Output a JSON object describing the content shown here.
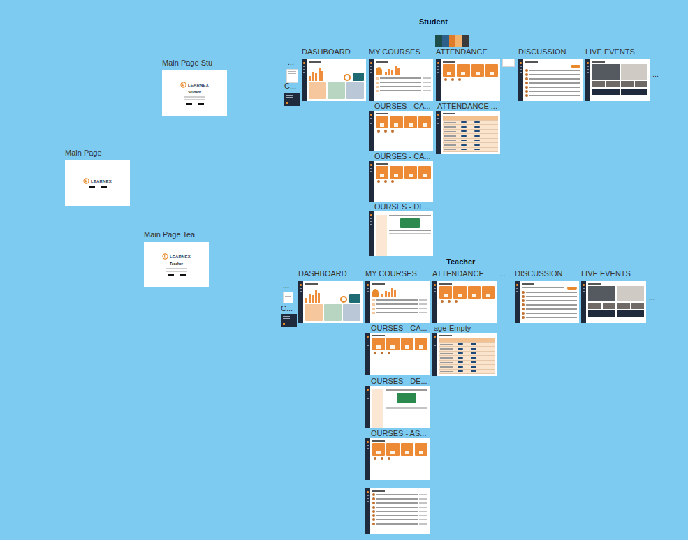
{
  "canvas": {
    "sections": [
      {
        "title": "Student"
      },
      {
        "title": "Teacher"
      }
    ]
  },
  "entry_pages": [
    {
      "label": "Main Page Stu",
      "logo": "LEARNEX",
      "heading": "Student"
    },
    {
      "label": "Main Page",
      "logo": "LEARNEX"
    },
    {
      "label": "Main Page Tea",
      "logo": "LEARNEX",
      "heading": "Teacher"
    }
  ],
  "student_frames": [
    {
      "label": "DASHBOARD",
      "kind": "dashboard"
    },
    {
      "label": "MY COURSES",
      "kind": "courses-overview"
    },
    {
      "label": "ATTENDANCE",
      "kind": "attendance-cards"
    },
    {
      "label": "DISCUSSION",
      "kind": "discussion"
    },
    {
      "label": "LIVE EVENTS",
      "kind": "live"
    },
    {
      "label": "OURSES - CA...",
      "kind": "course-cards"
    },
    {
      "label": "OURSES - CA...",
      "kind": "course-cards"
    },
    {
      "label": "OURSES - DE...",
      "kind": "detail"
    },
    {
      "label": "ATTENDANCE ...",
      "kind": "attendance-table"
    },
    {
      "label": "...",
      "kind": "mini"
    },
    {
      "label": "C...",
      "kind": "dark-mini"
    },
    {
      "label": "...",
      "kind": "mini"
    },
    {
      "label": "...",
      "kind": "note"
    },
    {
      "kind": "swatch"
    }
  ],
  "teacher_frames": [
    {
      "label": "DASHBOARD",
      "kind": "dashboard"
    },
    {
      "label": "MY COURSES",
      "kind": "courses-overview"
    },
    {
      "label": "ATTENDANCE",
      "kind": "attendance-cards"
    },
    {
      "label": "...",
      "kind": "note"
    },
    {
      "label": "DISCUSSION",
      "kind": "discussion"
    },
    {
      "label": "LIVE EVENTS",
      "kind": "live"
    },
    {
      "label": "OURSES - CA...",
      "kind": "course-cards"
    },
    {
      "label": "age-Empty",
      "kind": "attendance-table"
    },
    {
      "label": "OURSES - DE...",
      "kind": "detail"
    },
    {
      "label": "OURSES - AS...",
      "kind": "course-cards"
    },
    {
      "kind": "student-list"
    },
    {
      "label": "...",
      "kind": "mini"
    },
    {
      "label": "C...",
      "kind": "dark-mini"
    },
    {
      "label": "...",
      "kind": "note"
    }
  ]
}
